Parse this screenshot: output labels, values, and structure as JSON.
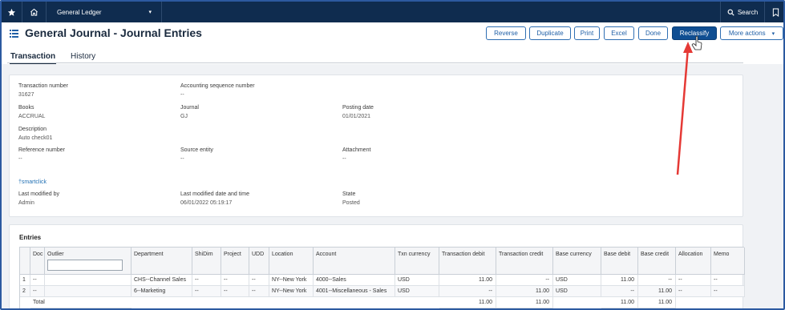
{
  "topbar": {
    "module": "General Ledger",
    "search_label": "Search",
    "icons": [
      "star-icon",
      "home-icon",
      "chevron-down-icon",
      "search-icon",
      "bookmark-icon"
    ]
  },
  "header": {
    "title": "General Journal - Journal Entries",
    "actions": {
      "reverse": "Reverse",
      "duplicate": "Duplicate",
      "print": "Print",
      "excel": "Excel",
      "done": "Done",
      "reclassify": "Reclassify",
      "more": "More actions"
    }
  },
  "tabs": [
    "Transaction",
    "History"
  ],
  "details": {
    "transaction_number": {
      "label": "Transaction number",
      "value": "31627"
    },
    "accounting_sequence": {
      "label": "Accounting sequence number",
      "value": "--"
    },
    "books": {
      "label": "Books",
      "value": "ACCRUAL"
    },
    "journal": {
      "label": "Journal",
      "value": "GJ"
    },
    "posting_date": {
      "label": "Posting date",
      "value": "01/01/2021"
    },
    "description": {
      "label": "Description",
      "value": "Auto check01"
    },
    "reference_number": {
      "label": "Reference number",
      "value": "--"
    },
    "source_entity": {
      "label": "Source entity",
      "value": "--"
    },
    "attachment": {
      "label": "Attachment",
      "value": "--"
    },
    "smartclick": "†smartclick",
    "last_modified_by": {
      "label": "Last modified by",
      "value": "Admin"
    },
    "last_modified_datetime": {
      "label": "Last modified date and time",
      "value": "06/01/2022 05:19:17"
    },
    "state": {
      "label": "State",
      "value": "Posted"
    }
  },
  "entries": {
    "title": "Entries",
    "columns": [
      "Doc",
      "Outlier",
      "Department",
      "ShiDim",
      "Project",
      "UDD",
      "Location",
      "Account",
      "Txn currency",
      "Transaction debit",
      "Transaction credit",
      "Base currency",
      "Base debit",
      "Base credit",
      "Allocation",
      "Memo"
    ],
    "rows": [
      {
        "n": "1",
        "doc": "--",
        "outlier": "",
        "department": "CHS--Channel Sales",
        "shidim": "--",
        "project": "--",
        "udd": "--",
        "location": "NY--New York",
        "account": "4000--Sales",
        "txn_currency": "USD",
        "txn_debit": "11.00",
        "txn_credit": "--",
        "base_currency": "USD",
        "base_debit": "11.00",
        "base_credit": "--",
        "allocation": "--",
        "memo": "--"
      },
      {
        "n": "2",
        "doc": "--",
        "outlier": "",
        "department": "6--Marketing",
        "shidim": "--",
        "project": "--",
        "udd": "--",
        "location": "NY--New York",
        "account": "4001--Miscellaneous - Sales",
        "txn_currency": "USD",
        "txn_debit": "--",
        "txn_credit": "11.00",
        "base_currency": "USD",
        "base_debit": "--",
        "base_credit": "11.00",
        "allocation": "--",
        "memo": "--"
      }
    ],
    "total": {
      "label": "Total",
      "txn_debit": "11.00",
      "txn_credit": "11.00",
      "base_debit": "11.00",
      "base_credit": "11.00"
    }
  },
  "annotation_color": "#e53935",
  "accent_color": "#0f4e92"
}
